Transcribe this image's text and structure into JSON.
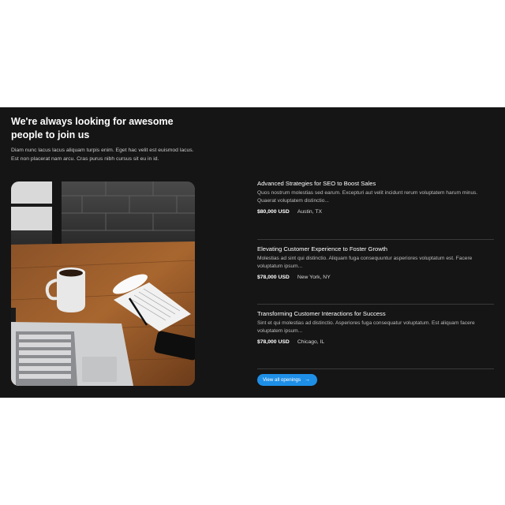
{
  "section": {
    "heading": "We're always looking for awesome people to join us",
    "intro": "Diam nunc lacus lacus aliquam turpis enim. Eget hac velit est euismod lacus. Est non placerat nam arcu. Cras purus nibh cursus sit eu in id."
  },
  "jobs": [
    {
      "title": "Advanced Strategies for SEO to Boost Sales",
      "description": "Quos nostrum molestias sed earum. Excepturi aut velit incidunt rerum voluptatem harum minus. Quaerat voluptatem distinctio...",
      "salary": "$80,000 USD",
      "location": "Austin, TX"
    },
    {
      "title": "Elevating Customer Experience to Foster Growth",
      "description": "Molestias ad sint qui distinctio. Aliquam fuga consequuntur asperiores voluptatum est. Facere voluptatum ipsum...",
      "salary": "$78,000 USD",
      "location": "New York, NY"
    },
    {
      "title": "Transforming Customer Interactions for Success",
      "description": "Sint et qui molestias ad distinctio. Asperiores fuga consequatur voluptatum. Est aliquam facere voluptatem ipsum...",
      "salary": "$78,000 USD",
      "location": "Chicago, IL"
    }
  ],
  "cta": {
    "label": "View all openings",
    "icon": "arrow-right-icon"
  },
  "colors": {
    "background": "#151515",
    "accent": "#1e8fe6",
    "divider": "#3a3a3a"
  }
}
